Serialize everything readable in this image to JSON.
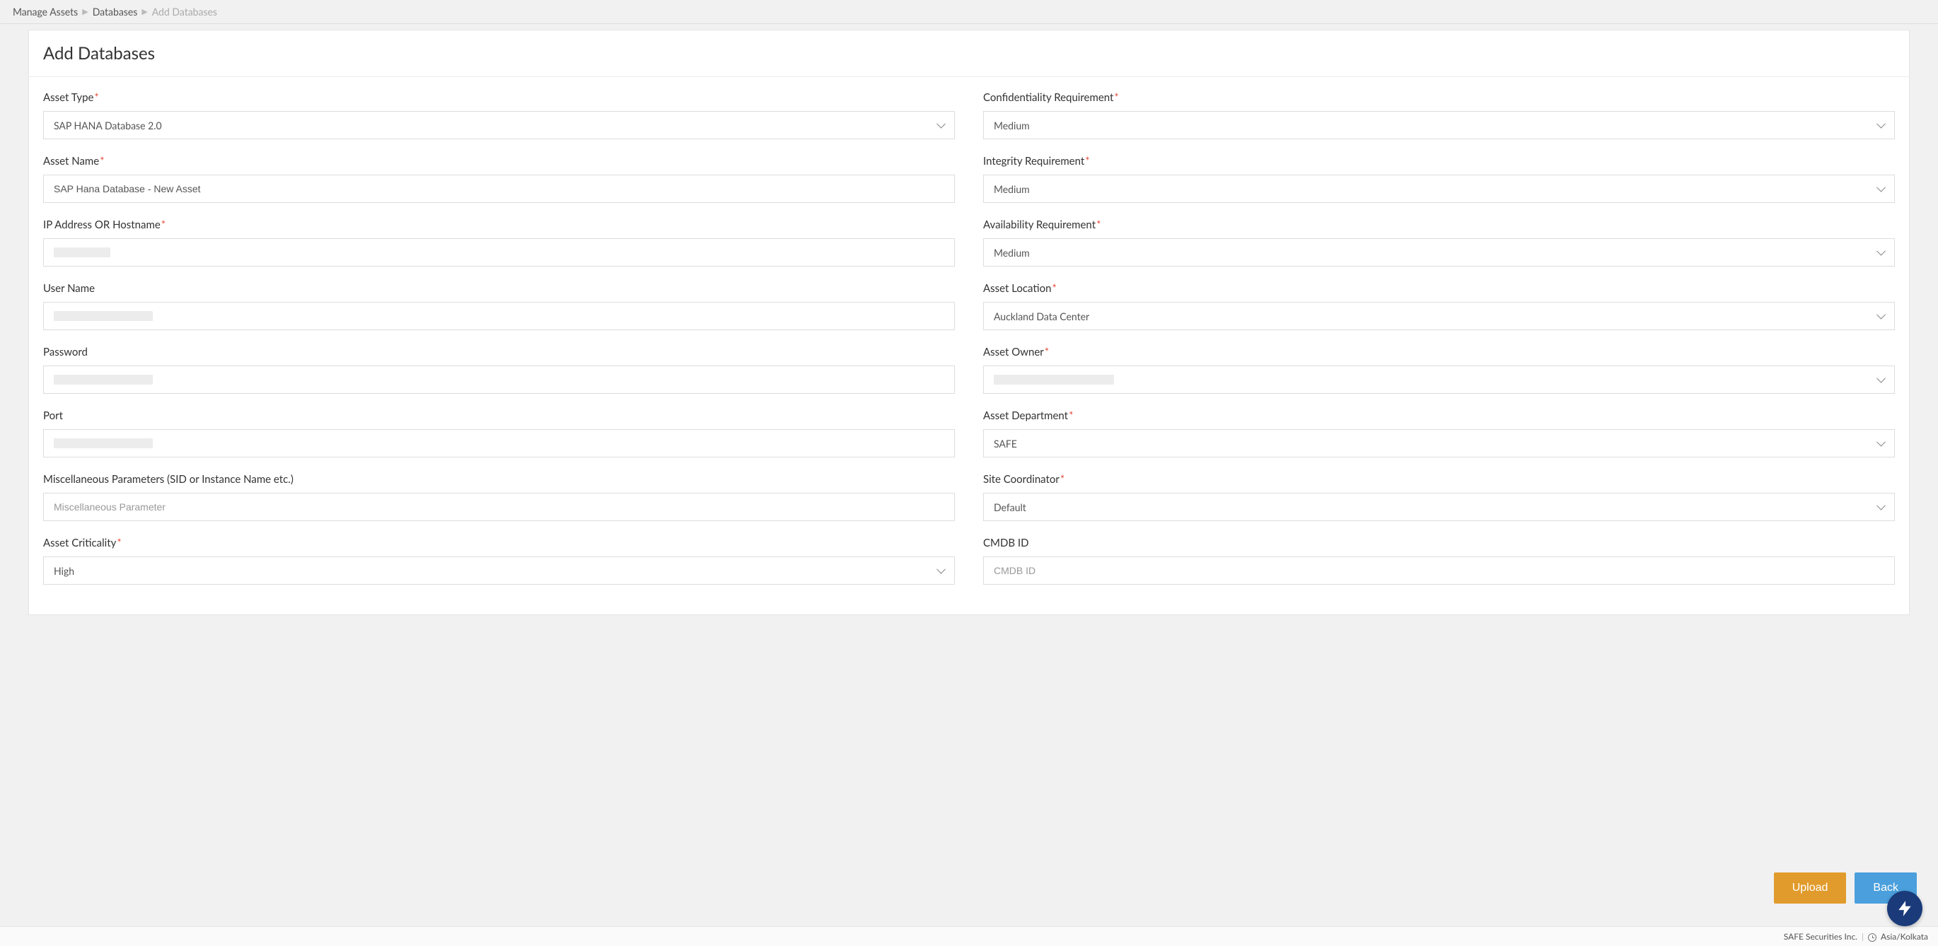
{
  "breadcrumb": {
    "items": [
      "Manage Assets",
      "Databases"
    ],
    "current": "Add Databases"
  },
  "page": {
    "title": "Add Databases"
  },
  "form": {
    "left": {
      "asset_type": {
        "label": "Asset Type",
        "required": true,
        "value": "SAP HANA Database 2.0",
        "kind": "select"
      },
      "asset_name": {
        "label": "Asset Name",
        "required": true,
        "value": "SAP Hana Database - New Asset",
        "kind": "text"
      },
      "ip_host": {
        "label": "IP Address OR Hostname",
        "required": true,
        "kind": "text",
        "redacted": true
      },
      "user_name": {
        "label": "User Name",
        "required": false,
        "kind": "text",
        "redacted": true
      },
      "password": {
        "label": "Password",
        "required": false,
        "kind": "password",
        "redacted": true
      },
      "port": {
        "label": "Port",
        "required": false,
        "kind": "text",
        "redacted": true
      },
      "misc": {
        "label": "Miscellaneous Parameters (SID or Instance Name etc.)",
        "required": false,
        "placeholder": "Miscellaneous Parameter",
        "kind": "text"
      },
      "criticality": {
        "label": "Asset Criticality",
        "required": true,
        "value": "High",
        "kind": "select"
      }
    },
    "right": {
      "confidentiality": {
        "label": "Confidentiality Requirement",
        "required": true,
        "value": "Medium",
        "kind": "select"
      },
      "integrity": {
        "label": "Integrity Requirement",
        "required": true,
        "value": "Medium",
        "kind": "select"
      },
      "availability": {
        "label": "Availability Requirement",
        "required": true,
        "value": "Medium",
        "kind": "select"
      },
      "location": {
        "label": "Asset Location",
        "required": true,
        "value": "Auckland Data Center",
        "kind": "select"
      },
      "owner": {
        "label": "Asset Owner",
        "required": true,
        "kind": "select",
        "redacted": true
      },
      "department": {
        "label": "Asset Department",
        "required": true,
        "value": "SAFE",
        "kind": "select"
      },
      "site_coord": {
        "label": "Site Coordinator",
        "required": true,
        "value": "Default",
        "kind": "select"
      },
      "cmdb_id": {
        "label": "CMDB ID",
        "required": false,
        "placeholder": "CMDB ID",
        "kind": "text"
      }
    }
  },
  "buttons": {
    "upload": "Upload",
    "back": "Back"
  },
  "footer": {
    "company": "SAFE Securities Inc.",
    "timezone": "Asia/Kolkata"
  }
}
